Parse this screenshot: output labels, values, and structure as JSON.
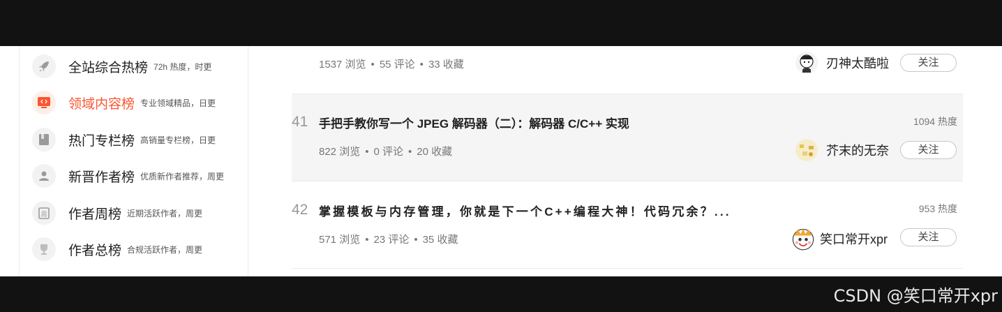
{
  "sidebar": {
    "items": [
      {
        "label": "全站综合热榜",
        "sub": "72h 热度，时更",
        "icon": "rocket-icon",
        "active": false
      },
      {
        "label": "领域内容榜",
        "sub": "专业领域精品，日更",
        "icon": "code-icon",
        "active": true
      },
      {
        "label": "热门专栏榜",
        "sub": "高销量专栏榜，日更",
        "icon": "book-icon",
        "active": false
      },
      {
        "label": "新晋作者榜",
        "sub": "优质新作者推荐，周更",
        "icon": "user-icon",
        "active": false
      },
      {
        "label": "作者周榜",
        "sub": "近期活跃作者，周更",
        "icon": "calendar-week-icon",
        "active": false
      },
      {
        "label": "作者总榜",
        "sub": "合规活跃作者，周更",
        "icon": "trophy-icon",
        "active": false
      }
    ],
    "accent_color": "#fc5531"
  },
  "articles": [
    {
      "rank": "",
      "title": "",
      "heat": "",
      "views": "1537 浏览",
      "comments": "55 评论",
      "favorites": "33 收藏",
      "author": "刃神太酷啦",
      "follow_label": "关注"
    },
    {
      "rank": "41",
      "title": "手把手教你写一个 JPEG 解码器（二）：解码器 C/C++ 实现",
      "heat": "1094 热度",
      "views": "822 浏览",
      "comments": "0 评论",
      "favorites": "20 收藏",
      "author": "芥末的无奈",
      "follow_label": "关注"
    },
    {
      "rank": "42",
      "title": "掌握模板与内存管理，你就是下一个C++编程大神！代码冗余？...",
      "heat": "953 热度",
      "views": "571 浏览",
      "comments": "23 评论",
      "favorites": "35 收藏",
      "author": "笑口常开xpr",
      "follow_label": "关注"
    }
  ],
  "separator": "•",
  "watermark": "CSDN @笑口常开xpr"
}
